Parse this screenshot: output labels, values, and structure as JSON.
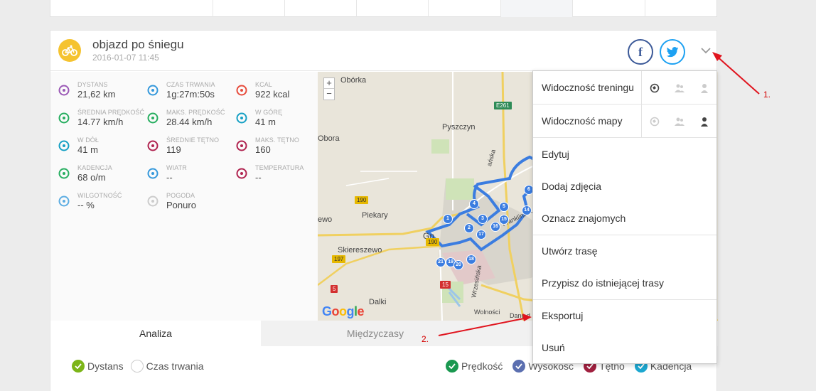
{
  "activity": {
    "title": "objazd po śniegu",
    "date": "2016-01-07 11:45"
  },
  "icons": {
    "sport": "bicycle-icon",
    "facebook": "facebook-icon",
    "twitter": "twitter-icon",
    "menu_toggle": "chevron-down-icon"
  },
  "social": {
    "facebook_glyph": "f"
  },
  "stats": [
    {
      "label": "DYSTANS",
      "value": "21,62 km",
      "icon": "distance-icon",
      "color": "#9b59b6"
    },
    {
      "label": "CZAS TRWANIA",
      "value": "1g:27m:50s",
      "icon": "stopwatch-icon",
      "color": "#3498db"
    },
    {
      "label": "KCAL",
      "value": "922 kcal",
      "icon": "flame-icon",
      "color": "#e74c3c"
    },
    {
      "label": "ŚREDNIA PRĘDKOŚĆ",
      "value": "14.77 km/h",
      "icon": "gauge-icon",
      "color": "#27ae60"
    },
    {
      "label": "MAKS. PRĘDKOŚĆ",
      "value": "28.44 km/h",
      "icon": "gauge-max-icon",
      "color": "#27ae60"
    },
    {
      "label": "W GÓRĘ",
      "value": "41 m",
      "icon": "ascent-icon",
      "color": "#16a0c4"
    },
    {
      "label": "W DÓŁ",
      "value": "41 m",
      "icon": "descent-icon",
      "color": "#16a0c4"
    },
    {
      "label": "ŚREDNIE TĘTNO",
      "value": "119",
      "icon": "heart-rate-icon",
      "color": "#b0234f"
    },
    {
      "label": "MAKS. TĘTNO",
      "value": "160",
      "icon": "heart-max-icon",
      "color": "#b0234f"
    },
    {
      "label": "KADENCJA",
      "value": "68 o/m",
      "icon": "cadence-icon",
      "color": "#27ae60"
    },
    {
      "label": "WIATR",
      "value": "--",
      "icon": "wind-icon",
      "color": "#3498db"
    },
    {
      "label": "TEMPERATURA",
      "value": "--",
      "icon": "thermometer-icon",
      "color": "#b0234f"
    },
    {
      "label": "WILGOTNOŚĆ",
      "value": "-- %",
      "icon": "humidity-icon",
      "color": "#5dade2"
    },
    {
      "label": "POGODA",
      "value": "Ponuro",
      "icon": "cloud-icon",
      "color": "#cccccc"
    }
  ],
  "map": {
    "zoom_in": "+",
    "zoom_out": "−",
    "google_logo": "Google",
    "labels": [
      "Obórka",
      "Pyszczyn",
      "Obora",
      "Piekary",
      "Skiereszewo",
      "Dalki",
      "Franklina R",
      "Wrzesińska",
      "Wolności",
      "Dane d",
      "Gn",
      "ańska",
      "ewo"
    ],
    "roads": [
      "E261",
      "190",
      "190",
      "197",
      "15",
      "5",
      "260"
    ],
    "markers": [
      "1",
      "2",
      "3",
      "4",
      "5",
      "6",
      "14",
      "15",
      "16",
      "17",
      "18",
      "19",
      "20",
      "21"
    ]
  },
  "tabs": {
    "analysis": "Analiza",
    "splits": "Międzyczasy"
  },
  "legend": {
    "left": [
      {
        "label": "Dystans",
        "checked": true,
        "color": "#7cb518"
      },
      {
        "label": "Czas trwania",
        "checked": false,
        "color": "#ffffff"
      }
    ],
    "right": [
      {
        "label": "Prędkość",
        "checked": true,
        "color": "#1a9850"
      },
      {
        "label": "Wysokość",
        "checked": true,
        "color": "#5b6fb0"
      },
      {
        "label": "Tętno",
        "checked": true,
        "color": "#a0203f"
      },
      {
        "label": "Kadencja",
        "checked": true,
        "color": "#1ca7d0"
      }
    ]
  },
  "menu": {
    "training_visibility": "Widoczność treningu",
    "map_visibility": "Widoczność mapy",
    "visibility_icons": [
      "public-icon",
      "friends-icon",
      "private-icon"
    ],
    "items": [
      {
        "label": "Edytuj",
        "name": "menu-edit"
      },
      {
        "label": "Dodaj zdjęcia",
        "name": "menu-add-photos"
      },
      {
        "label": "Oznacz znajomych",
        "name": "menu-tag-friends"
      },
      {
        "label": "Utwórz trasę",
        "name": "menu-create-route"
      },
      {
        "label": "Przypisz do istniejącej trasy",
        "name": "menu-assign-route"
      },
      {
        "label": "Eksportuj",
        "name": "menu-export"
      },
      {
        "label": "Usuń",
        "name": "menu-delete"
      }
    ]
  },
  "annotations": {
    "step1": "1.",
    "step2": "2."
  },
  "colors": {
    "accent_red": "#e0141e",
    "route_blue": "#3b7de0",
    "sport_yellow": "#f5c330"
  }
}
